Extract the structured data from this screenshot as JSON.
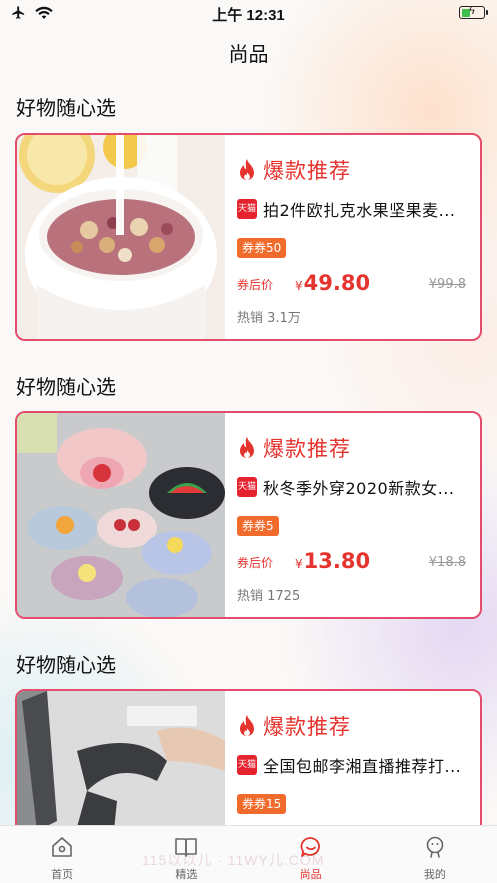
{
  "status_bar": {
    "time": "上午 12:31"
  },
  "nav": {
    "title": "尚品"
  },
  "sections": [
    {
      "title": "好物随心选",
      "card": {
        "badge": "爆款推荐",
        "store_badge": "天猫",
        "name": "拍2件欧扎克水果坚果麦...",
        "coupon": "券券50",
        "price_prefix": "券后价",
        "currency": "¥",
        "price": "49.80",
        "original_price": "¥99.8",
        "sales": "热销 3.1万"
      }
    },
    {
      "title": "好物随心选",
      "card": {
        "badge": "爆款推荐",
        "store_badge": "天猫",
        "name": "秋冬季外穿2020新款女...",
        "coupon": "券券5",
        "price_prefix": "券后价",
        "currency": "¥",
        "price": "13.80",
        "original_price": "¥18.8",
        "sales": "热销 1725"
      }
    },
    {
      "title": "好物随心选",
      "card": {
        "badge": "爆款推荐",
        "store_badge": "天猫",
        "name": "全国包邮李湘直播推荐打...",
        "coupon": "券券15"
      }
    }
  ],
  "tabs": [
    {
      "label": "首页",
      "icon": "home-icon"
    },
    {
      "label": "精选",
      "icon": "book-icon"
    },
    {
      "label": "尚品",
      "icon": "chat-bubble-icon",
      "active": true
    },
    {
      "label": "我的",
      "icon": "user-icon"
    }
  ],
  "watermark": "115以以儿 · 11WY儿.COM",
  "colors": {
    "accent": "#e5332e",
    "card_border": "#e34c6c",
    "coupon": "#f16b2c",
    "tmall": "#e4232f"
  }
}
